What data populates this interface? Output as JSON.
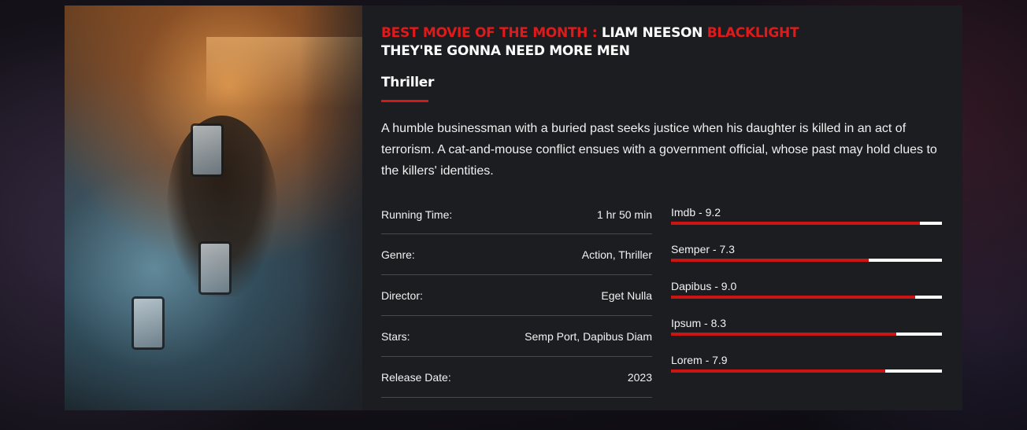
{
  "feature": {
    "prefix": "BEST MOVIE OF THE MONTH :",
    "actor": "LIAM NEESON",
    "movie": "BLACKLIGHT",
    "tagline": "THEY'RE GONNA NEED MORE MEN"
  },
  "genre_heading": "Thriller",
  "description": "A humble businessman with a buried past seeks justice when his daughter is killed in an act of terrorism. A cat-and-mouse conflict ensues with a government official, whose past may hold clues to the killers' identities.",
  "info": [
    {
      "label": "Running Time:",
      "value": "1 hr 50 min"
    },
    {
      "label": "Genre:",
      "value": "Action, Thriller"
    },
    {
      "label": "Director:",
      "value": "Eget Nulla"
    },
    {
      "label": "Stars:",
      "value": "Semp Port, Dapibus Diam"
    },
    {
      "label": "Release Date:",
      "value": "2023"
    }
  ],
  "ratings": [
    {
      "label": "Imdb - 9.2",
      "fraction": 0.92
    },
    {
      "label": "Semper - 7.3",
      "fraction": 0.73
    },
    {
      "label": "Dapibus - 9.0",
      "fraction": 0.9
    },
    {
      "label": "Ipsum - 8.3",
      "fraction": 0.83
    },
    {
      "label": "Lorem - 7.9",
      "fraction": 0.79
    }
  ],
  "colors": {
    "accent": "#e01a1a",
    "card_bg": "#1c1d21",
    "bar_track": "#ffffff"
  }
}
